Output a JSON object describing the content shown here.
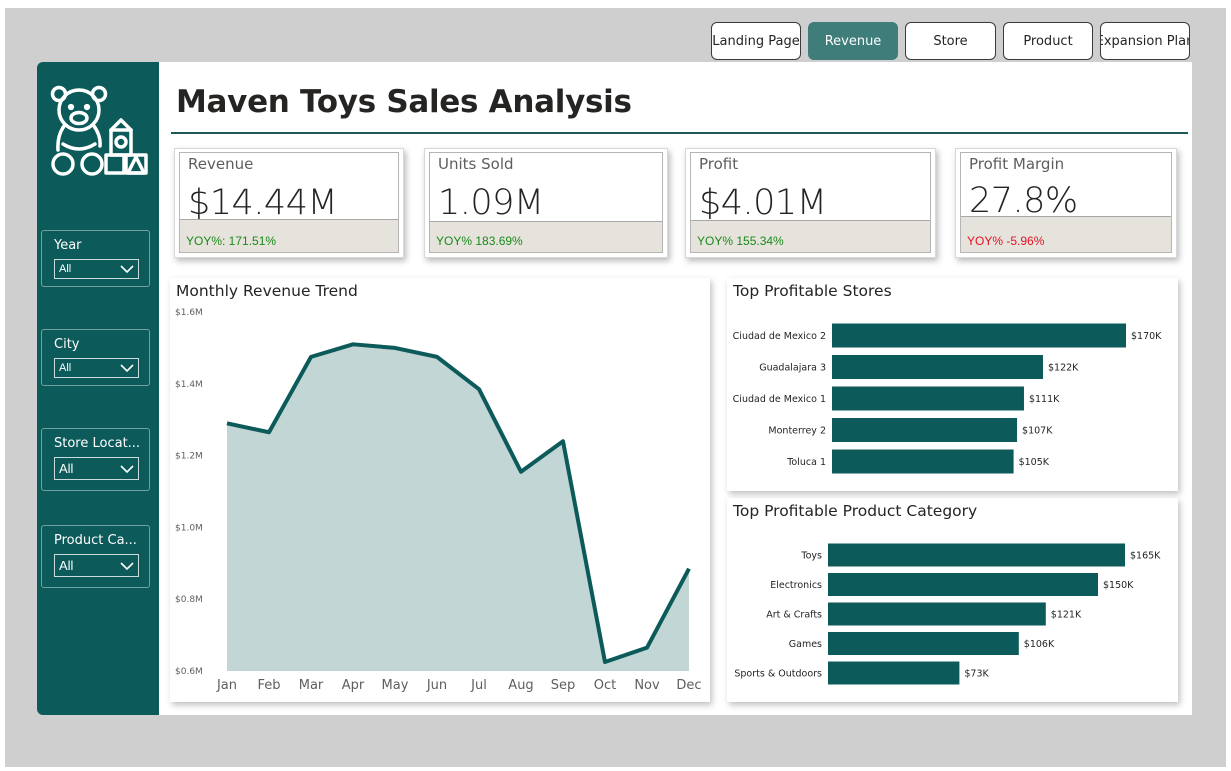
{
  "nav": {
    "buttons": [
      {
        "label": "Landing Page",
        "active": false
      },
      {
        "label": "Revenue",
        "active": true
      },
      {
        "label": "Store",
        "active": false
      },
      {
        "label": "Product",
        "active": false
      },
      {
        "label": "Expansion Plan",
        "active": false
      }
    ]
  },
  "sidebar": {
    "logo_icon": "teddy-bear-blocks-icon",
    "slicers": [
      {
        "title": "Year",
        "value": "All"
      },
      {
        "title": "City",
        "value": "All"
      },
      {
        "title": "Store Locat...",
        "value": "All"
      },
      {
        "title": "Product Ca...",
        "value": "All"
      }
    ]
  },
  "header": {
    "title": "Maven Toys Sales Analysis"
  },
  "kpis": [
    {
      "label": "Revenue",
      "value": "$14.44M",
      "yoy": "YOY%: 171.51%",
      "yoy_color": "#1a8a1a"
    },
    {
      "label": "Units Sold",
      "value": "1.09M",
      "yoy": "YOY% 183.69%",
      "yoy_color": "#1a8a1a"
    },
    {
      "label": "Profit",
      "value": "$4.01M",
      "yoy": "YOY% 155.34%",
      "yoy_color": "#1a8a1a"
    },
    {
      "label": "Profit Margin",
      "value": "27.8%",
      "yoy": "YOY% -5.96%",
      "yoy_color": "#e81123"
    }
  ],
  "colors": {
    "accent": "#0c5a5a",
    "area_fill": "#c1d6d5",
    "line": "#0c5a5a",
    "bar": "#0c5a5a",
    "active_nav": "#3e7d7a",
    "positive": "#1a8a1a",
    "negative": "#e81123"
  },
  "chart_data": [
    {
      "type": "area",
      "title": "Monthly Revenue Trend",
      "x": [
        "Jan",
        "Feb",
        "Mar",
        "Apr",
        "May",
        "Jun",
        "Jul",
        "Aug",
        "Sep",
        "Oct",
        "Nov",
        "Dec"
      ],
      "values": [
        1.29,
        1.265,
        1.475,
        1.51,
        1.5,
        1.475,
        1.385,
        1.155,
        1.24,
        0.625,
        0.665,
        0.885
      ],
      "ylim": [
        0.6,
        1.6
      ],
      "yticks": [
        0.6,
        0.8,
        1.0,
        1.2,
        1.4,
        1.6
      ],
      "ytick_labels": [
        "$0.6M",
        "$0.8M",
        "$1.0M",
        "$1.2M",
        "$1.4M",
        "$1.6M"
      ],
      "grid": false,
      "legend": "none"
    },
    {
      "type": "bar",
      "orientation": "horizontal",
      "title": "Top Profitable Stores",
      "categories": [
        "Ciudad de Mexico 2",
        "Guadalajara 3",
        "Ciudad de Mexico 1",
        "Monterrey 2",
        "Toluca 1"
      ],
      "values": [
        170,
        122,
        111,
        107,
        105
      ],
      "labels": [
        "$170K",
        "$122K",
        "$111K",
        "$107K",
        "$105K"
      ],
      "xlim": [
        0,
        170
      ],
      "legend": "none"
    },
    {
      "type": "bar",
      "orientation": "horizontal",
      "title": "Top Profitable Product Category",
      "categories": [
        "Toys",
        "Electronics",
        "Art & Crafts",
        "Games",
        "Sports & Outdoors"
      ],
      "values": [
        165,
        150,
        121,
        106,
        73
      ],
      "labels": [
        "$165K",
        "$150K",
        "$121K",
        "$106K",
        "$73K"
      ],
      "xlim": [
        0,
        165
      ],
      "legend": "none"
    }
  ]
}
